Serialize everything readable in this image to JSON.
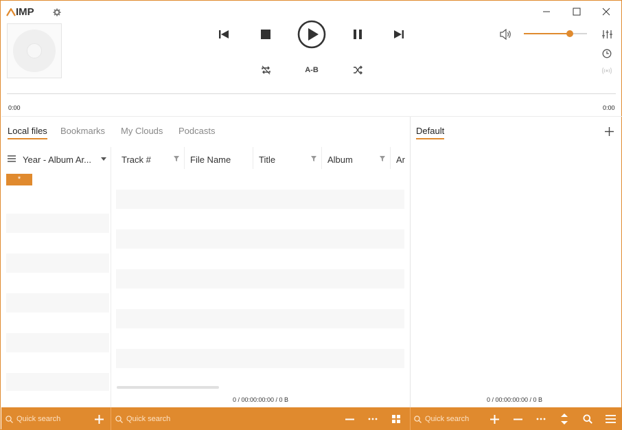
{
  "app": {
    "logo_text": "IMP",
    "accent": "#e08a2e"
  },
  "icons": {
    "settings": "gear-icon",
    "minimize": "minimize-icon",
    "maximize": "maximize-icon",
    "close": "close-icon",
    "prev": "previous-track-icon",
    "stop": "stop-icon",
    "play": "play-icon",
    "pause": "pause-icon",
    "next": "next-track-icon",
    "repeat": "repeat-icon",
    "shuffle": "shuffle-icon",
    "volume": "volume-icon",
    "equalizer": "equalizer-icon",
    "scheduler": "clock-icon",
    "radio": "broadcast-icon"
  },
  "transport": {
    "ab_label": "A-B"
  },
  "volume": {
    "level_percent": 73
  },
  "seek": {
    "position": "0:00",
    "duration": "0:00"
  },
  "library": {
    "tabs": [
      {
        "label": "Local files",
        "active": true
      },
      {
        "label": "Bookmarks",
        "active": false
      },
      {
        "label": "My Clouds",
        "active": false
      },
      {
        "label": "Podcasts",
        "active": false
      }
    ],
    "grouping_label": "Year - Album Ar...",
    "group_chip": "*",
    "columns": [
      {
        "label": "Track #",
        "filter": true
      },
      {
        "label": "File Name",
        "filter": false
      },
      {
        "label": "Title",
        "filter": true
      },
      {
        "label": "Album",
        "filter": true
      },
      {
        "label": "Ar",
        "filter": false
      }
    ],
    "status": "0 / 00:00:00:00 / 0 B",
    "search_placeholder_left": "Quick search",
    "search_placeholder_mid": "Quick search"
  },
  "playlist": {
    "tab_label": "Default",
    "status": "0 / 00:00:00:00 / 0 B",
    "search_placeholder": "Quick search"
  }
}
